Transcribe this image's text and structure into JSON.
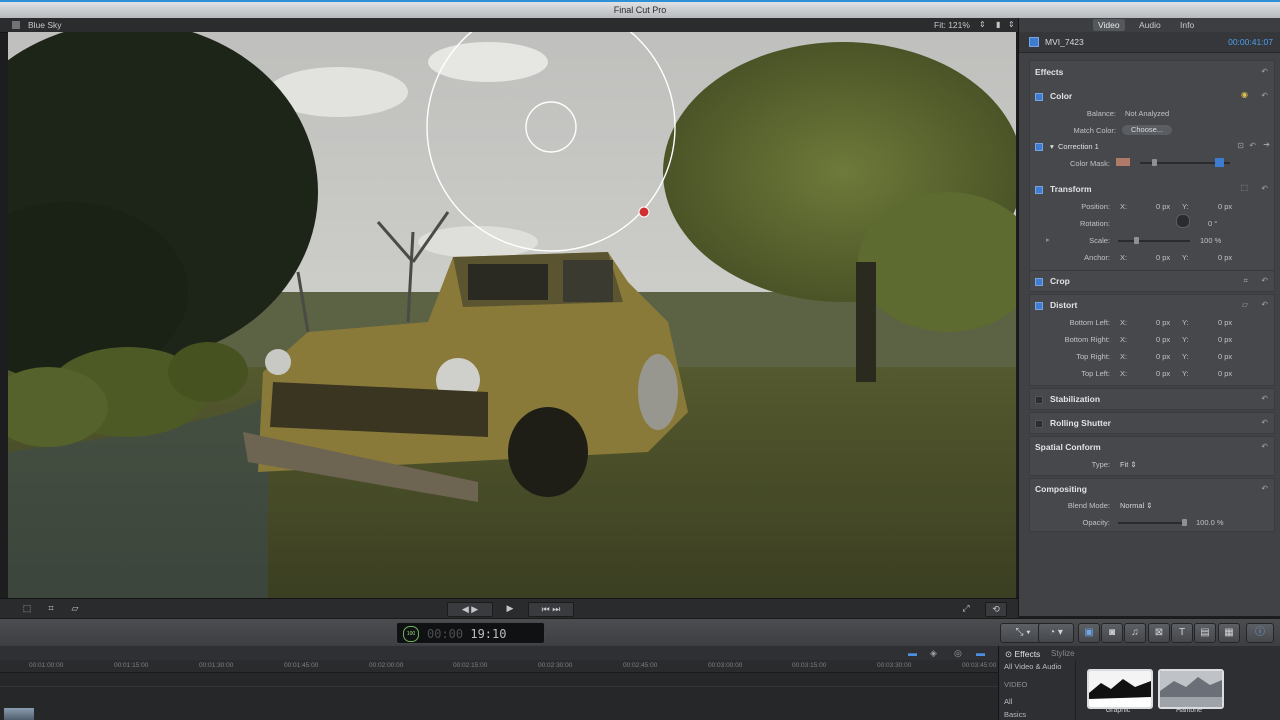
{
  "app": {
    "title": "Final Cut Pro"
  },
  "viewer": {
    "project_name": "Blue Sky",
    "fit_label": "Fit:",
    "fit_value": "121%",
    "controls": {
      "left": [
        "crop-icon",
        "transform-icon",
        "distort-icon"
      ],
      "play_prev": "◀",
      "play_next": "▶",
      "play": "▶",
      "to_start": "⏮",
      "to_end": "⏭"
    }
  },
  "inspector": {
    "tabs": [
      {
        "label": "Video",
        "active": true
      },
      {
        "label": "Audio",
        "active": false
      },
      {
        "label": "Info",
        "active": false
      }
    ],
    "clip_name": "MVI_7423",
    "clip_timecode": "00:00:41:07",
    "effects_header": "Effects",
    "color": {
      "title": "Color",
      "balance_label": "Balance:",
      "balance_value": "Not Analyzed",
      "match_label": "Match Color:",
      "match_button": "Choose...",
      "correction_title": "Correction 1",
      "mask_label": "Color Mask:"
    },
    "transform": {
      "title": "Transform",
      "position_label": "Position:",
      "rotation_label": "Rotation:",
      "rotation_value": "0 °",
      "scale_label": "Scale:",
      "scale_value": "100 %",
      "anchor_label": "Anchor:",
      "x": "X:",
      "y": "Y:",
      "zero_px": "0 px"
    },
    "crop": {
      "title": "Crop"
    },
    "distort": {
      "title": "Distort",
      "rows": [
        "Bottom Left:",
        "Bottom Right:",
        "Top Right:",
        "Top Left:"
      ]
    },
    "stabilization": {
      "title": "Stabilization"
    },
    "rolling_shutter": {
      "title": "Rolling Shutter"
    },
    "spatial_conform": {
      "title": "Spatial Conform",
      "type_label": "Type:",
      "type_value": "Fit"
    },
    "compositing": {
      "title": "Compositing",
      "blend_label": "Blend Mode:",
      "blend_value": "Normal",
      "opacity_label": "Opacity:",
      "opacity_value": "100.0  %"
    }
  },
  "toolbar": {
    "timecode_badge": "100",
    "timecode_dim": "00:00",
    "timecode": "19:10",
    "tools": [
      "select-tool-icon",
      "retime-icon",
      "video-browser-icon",
      "photo-browser-icon",
      "music-browser-icon",
      "transitions-icon",
      "titles-icon",
      "generators-icon",
      "themes-icon",
      "info-icon"
    ]
  },
  "timeline": {
    "ruler": [
      "00:01:00:00",
      "00:01:15:00",
      "00:01:30:00",
      "00:01:45:00",
      "00:02:00:00",
      "00:02:15:00",
      "00:02:30:00",
      "00:02:45:00",
      "00:03:00:00",
      "00:03:15:00",
      "00:03:30:00",
      "00:03:45:00"
    ]
  },
  "effects_browser": {
    "tab_active": "Effects",
    "tab_other": "Stylize",
    "categories": [
      "All Video & Audio",
      "VIDEO",
      "All",
      "Basics"
    ],
    "items": [
      "Graphic",
      "Halftone"
    ]
  },
  "colors": {
    "accent_blue": "#3d7cd0",
    "timecode_blue": "#4da0f0"
  }
}
